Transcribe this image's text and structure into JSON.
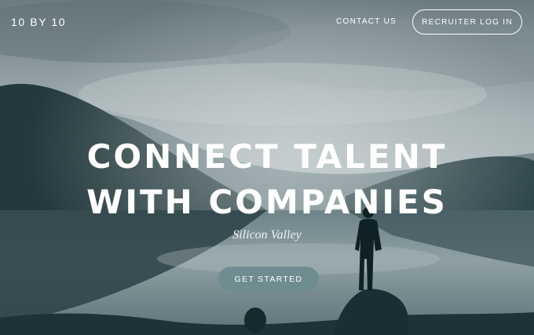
{
  "nav": {
    "logo": "10 BY 10",
    "contact_label": "CONTACT US",
    "login_label": "RECRUITER LOG IN"
  },
  "hero": {
    "headline_line1": "CONNECT TALENT",
    "headline_line2": "WITH COMPANIES",
    "subtitle": "Silicon Valley",
    "cta_label": "GET STARTED"
  },
  "colors": {
    "cta_background": "#6f8c91",
    "text": "#ffffff",
    "sky": "#9aa8ab",
    "water": "#7a8e93",
    "mountains": "#1f3a3e"
  }
}
